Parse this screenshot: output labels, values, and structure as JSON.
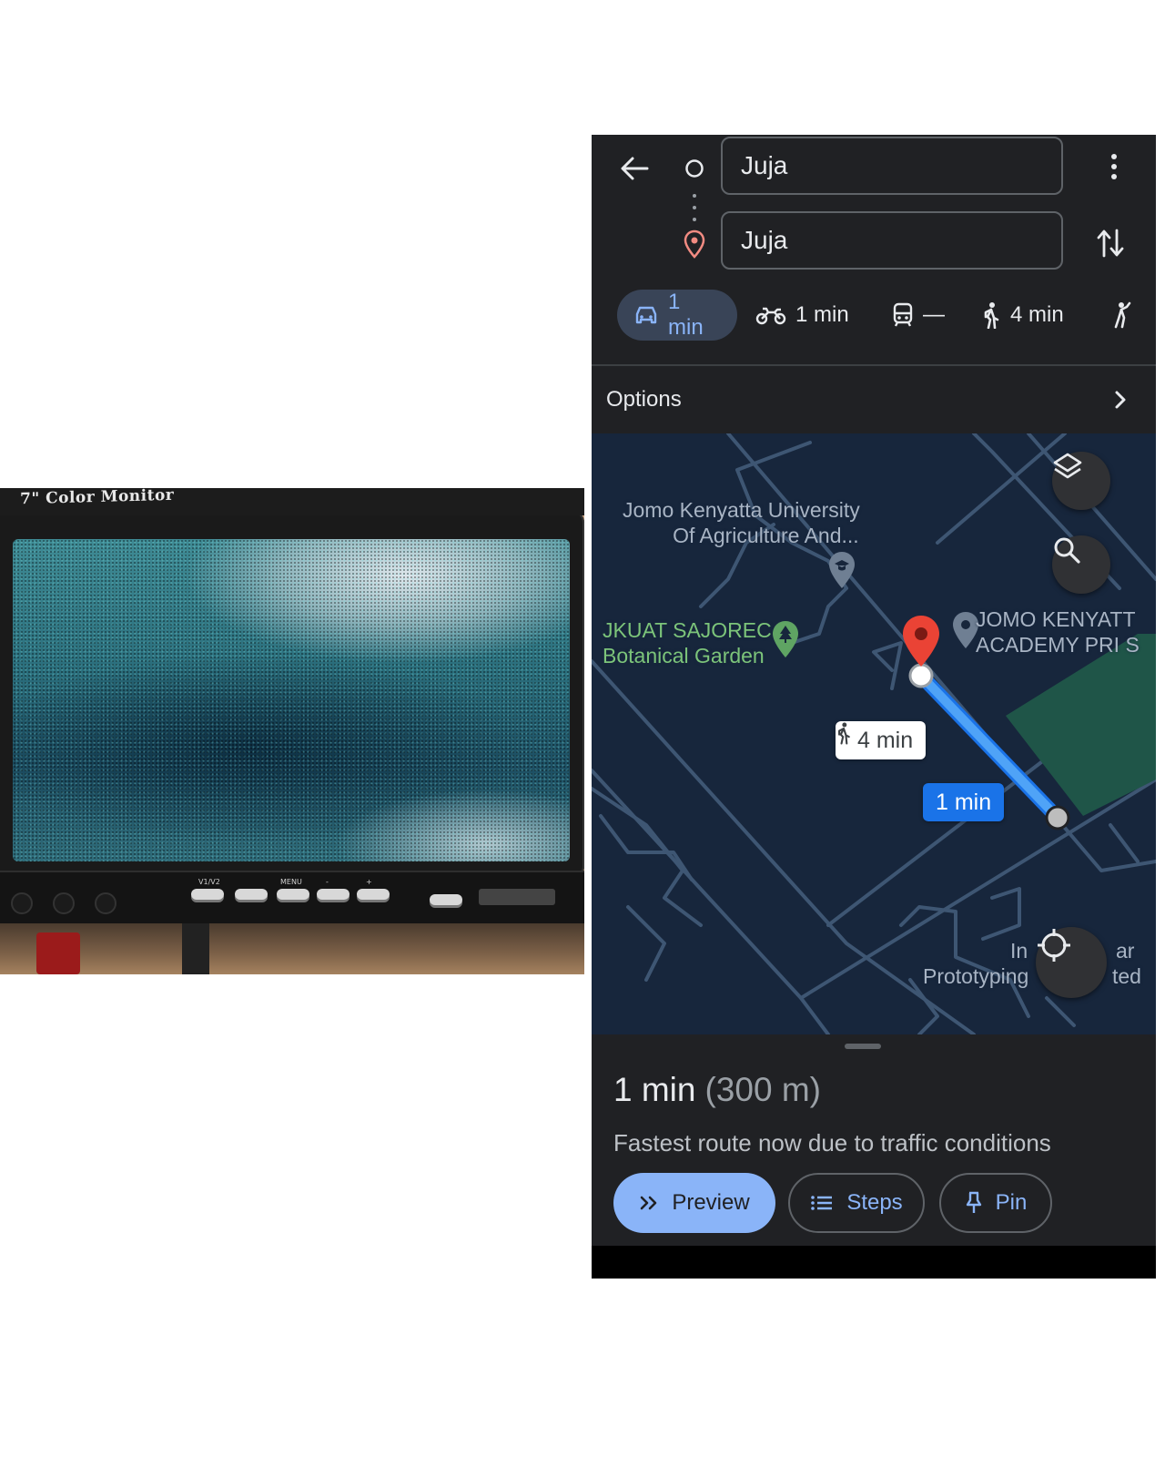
{
  "photo": {
    "monitor_label": "7\" Color Monitor",
    "button_labels": [
      "V1/V2",
      "",
      "MENU",
      "-",
      "+"
    ]
  },
  "maps": {
    "origin": {
      "value": "Juja"
    },
    "destination": {
      "value": "Juja"
    },
    "modes": [
      {
        "name": "driving",
        "icon": "car-icon",
        "label": "1 min",
        "active": true
      },
      {
        "name": "motorcycle",
        "icon": "motorcycle-icon",
        "label": "1 min"
      },
      {
        "name": "transit",
        "icon": "train-icon",
        "label": "—"
      },
      {
        "name": "walking",
        "icon": "walk-icon",
        "label": "4 min"
      },
      {
        "name": "more",
        "icon": "ride-icon",
        "label": ""
      }
    ],
    "options_label": "Options",
    "map": {
      "labels": {
        "jkuat": [
          "Jomo Kenyatta University",
          "Of Agriculture And..."
        ],
        "garden": [
          "JKUAT SAJOREC",
          "Botanical Garden"
        ],
        "academy": [
          "JOMO KENYATT",
          "ACADEMY PRI S"
        ],
        "prototyping": "Prototyping",
        "partial_in": "In",
        "partial_ar": "ar",
        "partial_ted": "ted"
      },
      "walk_bubble": "4 min",
      "drive_bubble": "1 min",
      "route_color": "#4fa3f7"
    },
    "summary": {
      "time": "1 min",
      "distance": "(300 m)"
    },
    "route_note": "Fastest route now due to traffic conditions",
    "buttons": {
      "preview": "Preview",
      "steps": "Steps",
      "pin": "Pin"
    },
    "accent": "#8ab4f8"
  }
}
